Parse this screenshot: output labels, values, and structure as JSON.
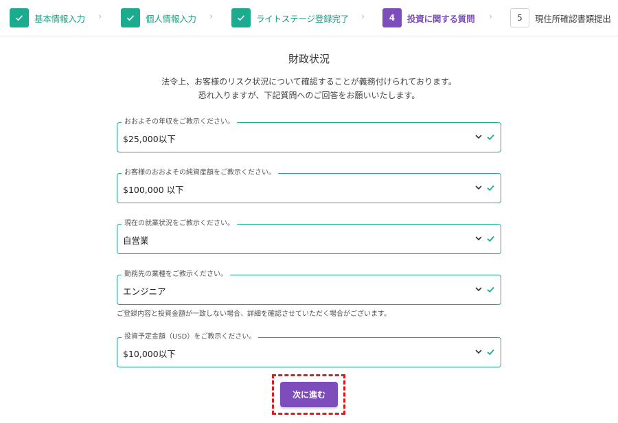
{
  "stepper": {
    "steps": [
      {
        "number": "",
        "label": "基本情報入力",
        "status": "done"
      },
      {
        "number": "",
        "label": "個人情報入力",
        "status": "done"
      },
      {
        "number": "",
        "label": "ライトステージ登録完了",
        "status": "done"
      },
      {
        "number": "4",
        "label": "投資に関する質問",
        "status": "active"
      },
      {
        "number": "5",
        "label": "現住所確認書類提出",
        "status": "pending"
      }
    ],
    "separator": "›"
  },
  "page": {
    "title": "財政状況",
    "description_line1": "法令上、お客様のリスク状況について確認することが義務付けられております。",
    "description_line2": "恐れ入りますが、下記質問へのご回答をお願いいたします。"
  },
  "fields": [
    {
      "label": "おおよその年収をご教示ください。",
      "value": "$25,000以下"
    },
    {
      "label": "お客様のおおよその純資産額をご教示ください。",
      "value": "$100,000 以下"
    },
    {
      "label": "現在の就業状況をご教示ください。",
      "value": "自営業"
    },
    {
      "label": "勤務先の業種をご教示ください。",
      "value": "エンジニア"
    },
    {
      "label": "投資予定金額（USD）をご教示ください。",
      "value": "$10,000以下"
    }
  ],
  "note": "ご登録内容と投資金額が一致しない場合、詳細を確認させていただく場合がございます。",
  "next_button_label": "次に進む",
  "colors": {
    "accent_green": "#1bab8f",
    "accent_purple": "#7c4dbb",
    "highlight_red": "#e01818"
  }
}
